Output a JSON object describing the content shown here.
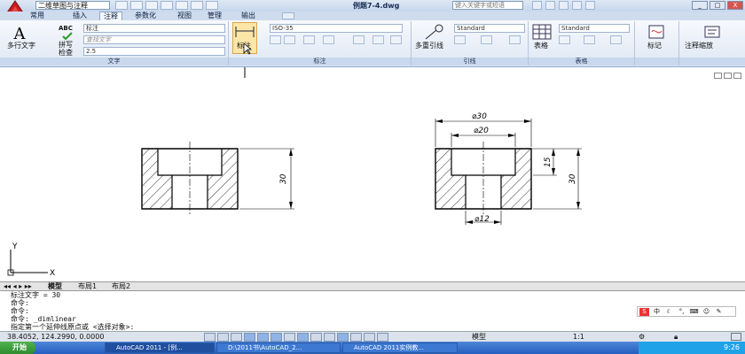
{
  "titlebar": {
    "workspace": "二维草图与注释",
    "document_title": "例题7-4.dwg",
    "search_placeholder": "键入关键字或短语",
    "win_minimize": "_",
    "win_maximize": "□",
    "win_close": "X"
  },
  "ribbon_tabs": [
    "常用",
    "插入",
    "注释",
    "参数化",
    "视图",
    "管理",
    "输出"
  ],
  "active_tab": "注释",
  "text_panel": {
    "multiline_text": "多行文字",
    "spell_check": "拼写\n检查",
    "abc": "ABC",
    "style_value": "标注",
    "find_placeholder": "查找文字",
    "height_value": "2.5",
    "label": "文字"
  },
  "dim_panel": {
    "linear_label": "标注",
    "dim_style_value": "ISO-35",
    "label": "标注"
  },
  "leader_panel": {
    "multileader": "多重引线",
    "style_value": "Standard",
    "label": "引线"
  },
  "table_panel": {
    "table": "表格",
    "style_value": "Standard",
    "label": "表格"
  },
  "mark_panel": {
    "markup": "标记"
  },
  "scale_panel": {
    "annotation_scale": "注释缩放"
  },
  "drawing": {
    "left_dim": "30",
    "right_dim_outer": "30",
    "right_dim_inner": "15",
    "dia_30": "⌀30",
    "dia_20": "⌀20",
    "dia_12": "⌀12"
  },
  "ucs": {
    "x": "X",
    "y": "Y"
  },
  "layout_tabs": [
    "模型",
    "布局1",
    "布局2"
  ],
  "command_lines": [
    "标注文字 = 30",
    "命令:",
    "命令:",
    "命令: _dimlinear",
    "指定第一个延伸线原点或 <选择对象>:"
  ],
  "status": {
    "coords": "38.4052, 124.2990, 0.0000",
    "model": "模型",
    "scale": "1:1"
  },
  "taskbar": {
    "start": "开始",
    "tasks": [
      "AutoCAD 2011 - [例...",
      "D:\\2011书\\AutoCAD_2...",
      "AutoCAD 2011实例教..."
    ],
    "time": "9:26"
  },
  "colors": {
    "ribbon_bg": "#dde7f4",
    "taskbar": "#245ebf",
    "start": "#2f8b2f"
  }
}
